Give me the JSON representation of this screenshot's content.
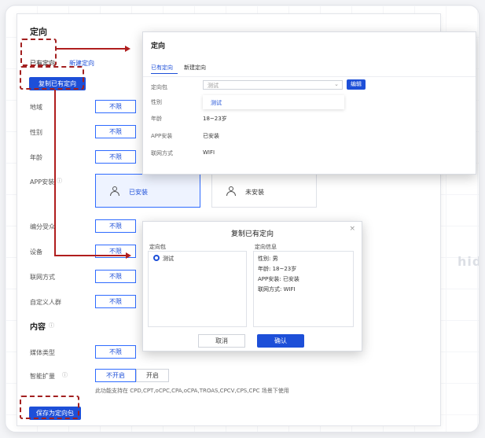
{
  "main": {
    "section_title": "定向",
    "tabs": [
      {
        "label": "已有定向"
      },
      {
        "label": "新建定向"
      }
    ],
    "copy_button": "复制已有定向",
    "rows": [
      {
        "label": "地域",
        "option": "不限"
      },
      {
        "label": "性别",
        "option": "不限"
      },
      {
        "label": "年龄",
        "option": "不限"
      },
      {
        "label": "APP安装"
      },
      {
        "label": "编分受众",
        "option": "不限"
      },
      {
        "label": "设备",
        "option": "不限"
      },
      {
        "label": "联网方式",
        "option": "不限"
      },
      {
        "label": "自定义人群",
        "option": "不限"
      }
    ],
    "app_cards": {
      "installed": "已安装",
      "not_installed": "未安装"
    },
    "content_title": "内容",
    "media_type": {
      "label": "媒体类型",
      "option": "不限"
    },
    "smart_expand": {
      "label": "智能扩量",
      "off": "不开启",
      "on": "开启"
    },
    "note": "此功能支持在 CPD,CPT,oCPC,CPA,oCPA,TROAS,CPCV,CPS,CPC 场景下使用",
    "save_button": "保存为定向包"
  },
  "popup": {
    "title": "定向",
    "tabs": [
      {
        "label": "已有定向"
      },
      {
        "label": "新建定向"
      }
    ],
    "package_label": "定向包",
    "package_value": "测试",
    "edit_button": "编辑",
    "dropdown_option": "测试",
    "rows": [
      {
        "label": "性别",
        "value": ""
      },
      {
        "label": "年龄",
        "value": "18~23岁"
      },
      {
        "label": "APP安装",
        "value": "已安装"
      },
      {
        "label": "联网方式",
        "value": "WIFI"
      }
    ]
  },
  "modal": {
    "title": "复制已有定向",
    "left_header": "定向包",
    "left_item": "测试",
    "right_header": "定向信息",
    "info": [
      "性别: 男",
      "年龄: 18~23岁",
      "APP安装: 已安装",
      "联网方式: WIFI"
    ],
    "cancel": "取消",
    "confirm": "确认"
  },
  "watermarks": [
    "hid",
    "hid",
    "hid",
    "hid"
  ],
  "colors": {
    "accent": "#1d4fd8",
    "highlight": "#a32020"
  }
}
